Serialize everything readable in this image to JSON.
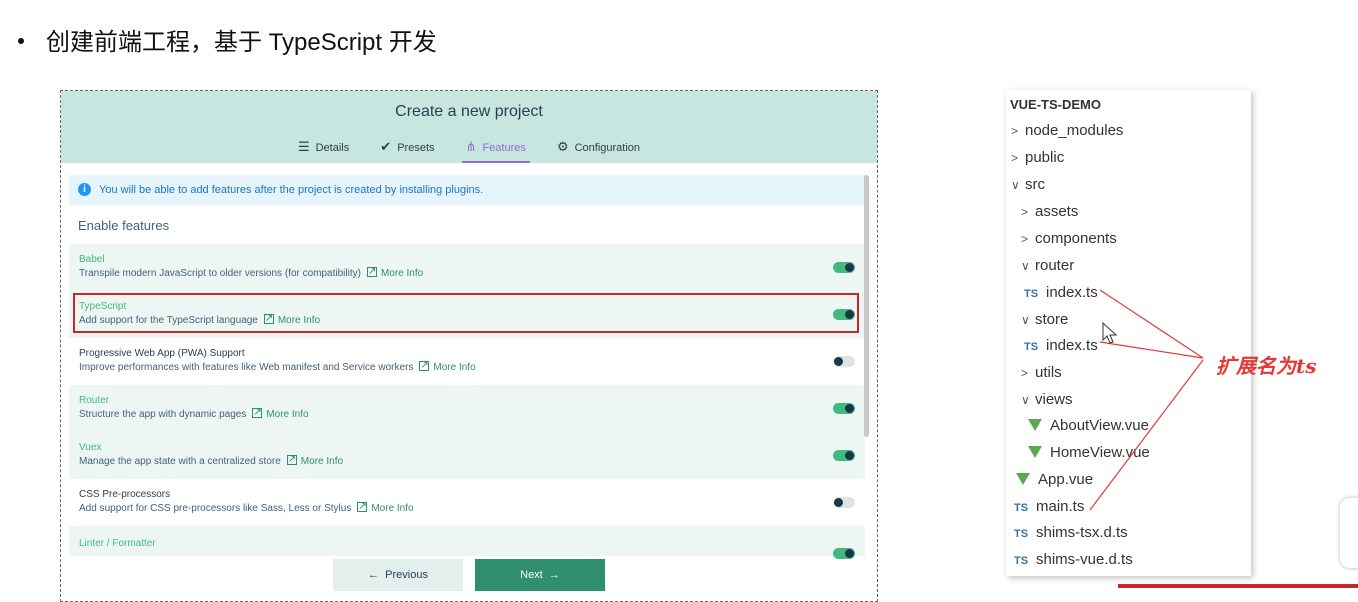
{
  "slide": {
    "bullet_text": "创建前端工程，基于 TypeScript 开发"
  },
  "vue_ui": {
    "title": "Create a new project",
    "tabs": [
      {
        "label": "Details",
        "icon": "list-icon"
      },
      {
        "label": "Presets",
        "icon": "check-circle-icon"
      },
      {
        "label": "Features",
        "icon": "fork-icon",
        "active": true
      },
      {
        "label": "Configuration",
        "icon": "gear-icon"
      }
    ],
    "info_text": "You will be able to add features after the project is created by installing plugins.",
    "enable_title": "Enable features",
    "more_info_label": "More Info",
    "features": [
      {
        "name": "Babel",
        "desc": "Transpile modern JavaScript to older versions (for compatibility)",
        "enabled": true
      },
      {
        "name": "TypeScript",
        "desc": "Add support for the TypeScript language",
        "enabled": true
      },
      {
        "name": "Progressive Web App (PWA) Support",
        "desc": "Improve performances with features like Web manifest and Service workers",
        "enabled": false
      },
      {
        "name": "Router",
        "desc": "Structure the app with dynamic pages",
        "enabled": true
      },
      {
        "name": "Vuex",
        "desc": "Manage the app state with a centralized store",
        "enabled": true
      },
      {
        "name": "CSS Pre-processors",
        "desc": "Add support for CSS pre-processors like Sass, Less or Stylus",
        "enabled": false
      },
      {
        "name": "Linter / Formatter",
        "desc": "",
        "enabled": true
      }
    ],
    "previous_label": "Previous",
    "next_label": "Next"
  },
  "explorer": {
    "title": "VUE-TS-DEMO",
    "items": [
      {
        "label": "node_modules",
        "kind": "folder",
        "expanded": false
      },
      {
        "label": "public",
        "kind": "folder",
        "expanded": false
      },
      {
        "label": "src",
        "kind": "folder",
        "expanded": true
      },
      {
        "label": "assets",
        "kind": "folder",
        "expanded": false
      },
      {
        "label": "components",
        "kind": "folder",
        "expanded": false
      },
      {
        "label": "router",
        "kind": "folder",
        "expanded": true
      },
      {
        "label": "index.ts",
        "kind": "ts"
      },
      {
        "label": "store",
        "kind": "folder",
        "expanded": true
      },
      {
        "label": "index.ts",
        "kind": "ts"
      },
      {
        "label": "utils",
        "kind": "folder",
        "expanded": false
      },
      {
        "label": "views",
        "kind": "folder",
        "expanded": true
      },
      {
        "label": "AboutView.vue",
        "kind": "vue"
      },
      {
        "label": "HomeView.vue",
        "kind": "vue"
      },
      {
        "label": "App.vue",
        "kind": "vue"
      },
      {
        "label": "main.ts",
        "kind": "ts"
      },
      {
        "label": "shims-tsx.d.ts",
        "kind": "ts"
      },
      {
        "label": "shims-vue.d.ts",
        "kind": "ts"
      }
    ],
    "ts_badge": "TS"
  },
  "annotation": {
    "text": "扩展名为ts",
    "color": "#e53935"
  },
  "colors": {
    "accent_green": "#42b983",
    "header_bg": "#c7e6df",
    "tab_active": "#8f6cd6"
  }
}
